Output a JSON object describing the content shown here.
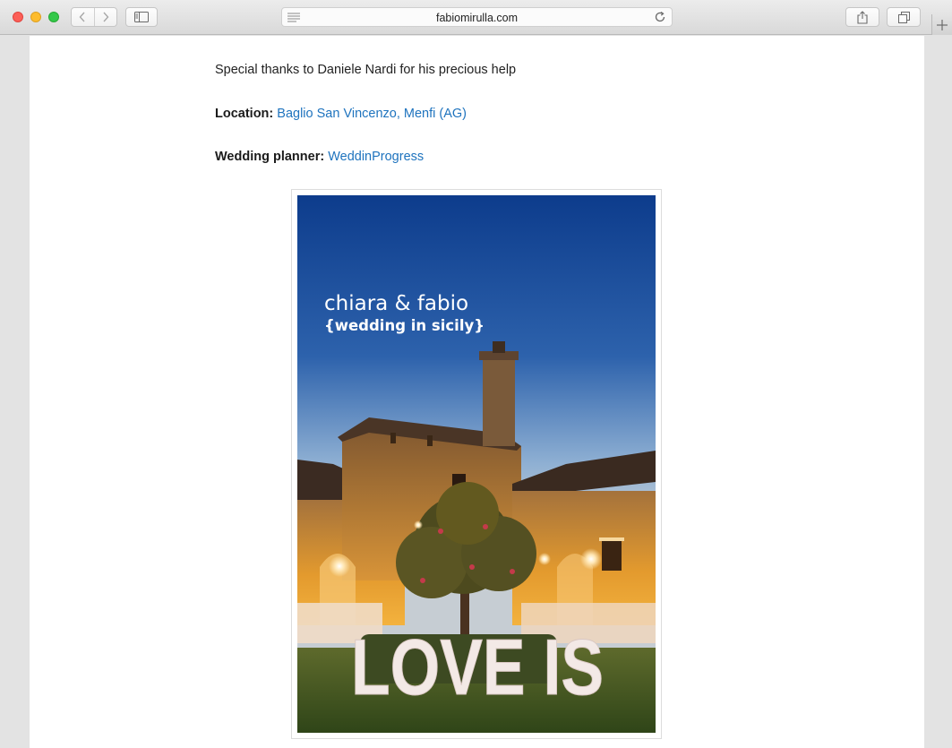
{
  "browser": {
    "url": "fabiomirulla.com",
    "icons": [
      "back-icon",
      "forward-icon",
      "sidebar-icon",
      "reader-icon",
      "reload-icon",
      "share-icon",
      "tabs-icon",
      "plus-icon"
    ]
  },
  "article": {
    "thanks": "Special thanks to Daniele Nardi for his precious help",
    "location_label": "Location:",
    "location_link": "Baglio San Vincenzo, Menfi (AG)",
    "planner_label": "Wedding planner:",
    "planner_link": "WeddinProgress"
  },
  "photo": {
    "title": "chiara & fabio",
    "subtitle": "{wedding in sicily}",
    "sign": "LOVE IS"
  },
  "colors": {
    "link": "#1e73be",
    "sky_top": "#0f3e8e",
    "lights": "#f0a02a"
  }
}
